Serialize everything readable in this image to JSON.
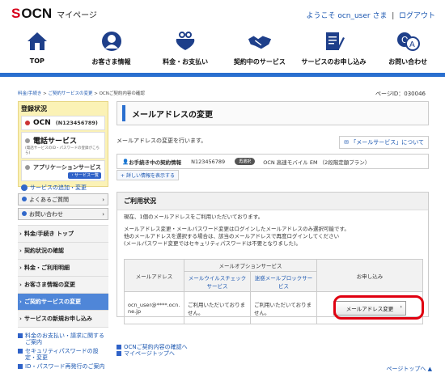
{
  "header": {
    "logo_mark": "S",
    "logo_brand": "OCN",
    "logo_title": "マイページ",
    "welcome": "ようこそ ocn_user さま",
    "separator": "|",
    "logout": "ログアウト"
  },
  "gnav": [
    {
      "label": "TOP",
      "icon": "home-icon"
    },
    {
      "label": "お客さま情報",
      "icon": "user-icon"
    },
    {
      "label": "料金・お支払い",
      "icon": "wallet-icon"
    },
    {
      "label": "契約中のサービス",
      "icon": "handshake-icon"
    },
    {
      "label": "サービスのお申し込み",
      "icon": "document-icon"
    },
    {
      "label": "お問い合わせ",
      "icon": "faq-icon"
    }
  ],
  "breadcrumb": {
    "item1": "料金/手続き",
    "sep": ">",
    "item2": "ご契約サービスの変更",
    "item3": "OCNご契約内容の確認"
  },
  "page_id": "ページID：030046",
  "sidebar": {
    "reg_title": "登録状況",
    "ocn_label": "OCN",
    "ocn_id": "(N123456789)",
    "phone_label": "電話サービス",
    "phone_sub": "(電話サービスのID・パスワードの登録がこちら)",
    "app_label": "アプリケーションサービス",
    "app_btn": "・サービス一覧",
    "reg_link": "サービスの追加・変更",
    "faq_btn": "よくあるご質問",
    "contact_btn": "お問い合わせ",
    "menu": [
      {
        "label": "料金/手続き トップ",
        "active": false
      },
      {
        "label": "契約状況の確認",
        "active": false
      },
      {
        "label": "料金・ご利用明細",
        "active": false
      },
      {
        "label": "お客さま情報の変更",
        "active": false
      },
      {
        "label": "ご契約サービスの変更",
        "active": true
      },
      {
        "label": "サービスの新規お申し込み",
        "active": false
      }
    ],
    "links": [
      "料金のお支払い・請求に関するご案内",
      "セキュリティパスワードの設定・変更",
      "ID・パスワード再発行のご案内"
    ]
  },
  "main": {
    "title": "メールアドレスの変更",
    "desc": "メールアドレスの変更を行います。",
    "service_link": "「メールサービス」について",
    "contract_label": "お手続き中の契約情報",
    "contract_num": "N123456789",
    "contract_pill": "再選択",
    "contract_plan": "OCN 高速モバイル EM （2段階定額プラン）",
    "detail_link": "詳しい情報を表示する",
    "usage_title": "ご利用状況",
    "usage_text1": "現在、1個のメールアドレスをご利用いただいております。",
    "usage_text2": "メールアドレス変更・メールパスワード変更はログインしたメールアドレスのみ選択可能です。",
    "usage_text3": "他のメールアドレスを選択する場合は、該当のメールアドレスで再度ログインしてください",
    "usage_text4": "(メールパスワード変更ではセキュリティパスワードは不要となりました)。",
    "table": {
      "col_mail": "メールアドレス",
      "col_option": "メールオプションサービス",
      "col_virus": "メールウイルスチェックサービス",
      "col_block": "迷惑メールブロックサービス",
      "col_apply": "お申し込み",
      "row_mail": "ocn_user@****.ocn.ne.jp",
      "row_virus": "ご利用いただいておりません。",
      "row_block": "ご利用いただいておりません。",
      "row_btn": "メールアドレス変更"
    },
    "bottom_link1": "OCNご契約内容の確認へ",
    "bottom_link2": "マイページトップへ"
  },
  "page_top": "ページトップへ",
  "colors": {
    "brand_red": "#d7001a",
    "nav_blue": "#2a6fcf",
    "highlight": "#e00010",
    "active_menu": "#4f86d8"
  }
}
